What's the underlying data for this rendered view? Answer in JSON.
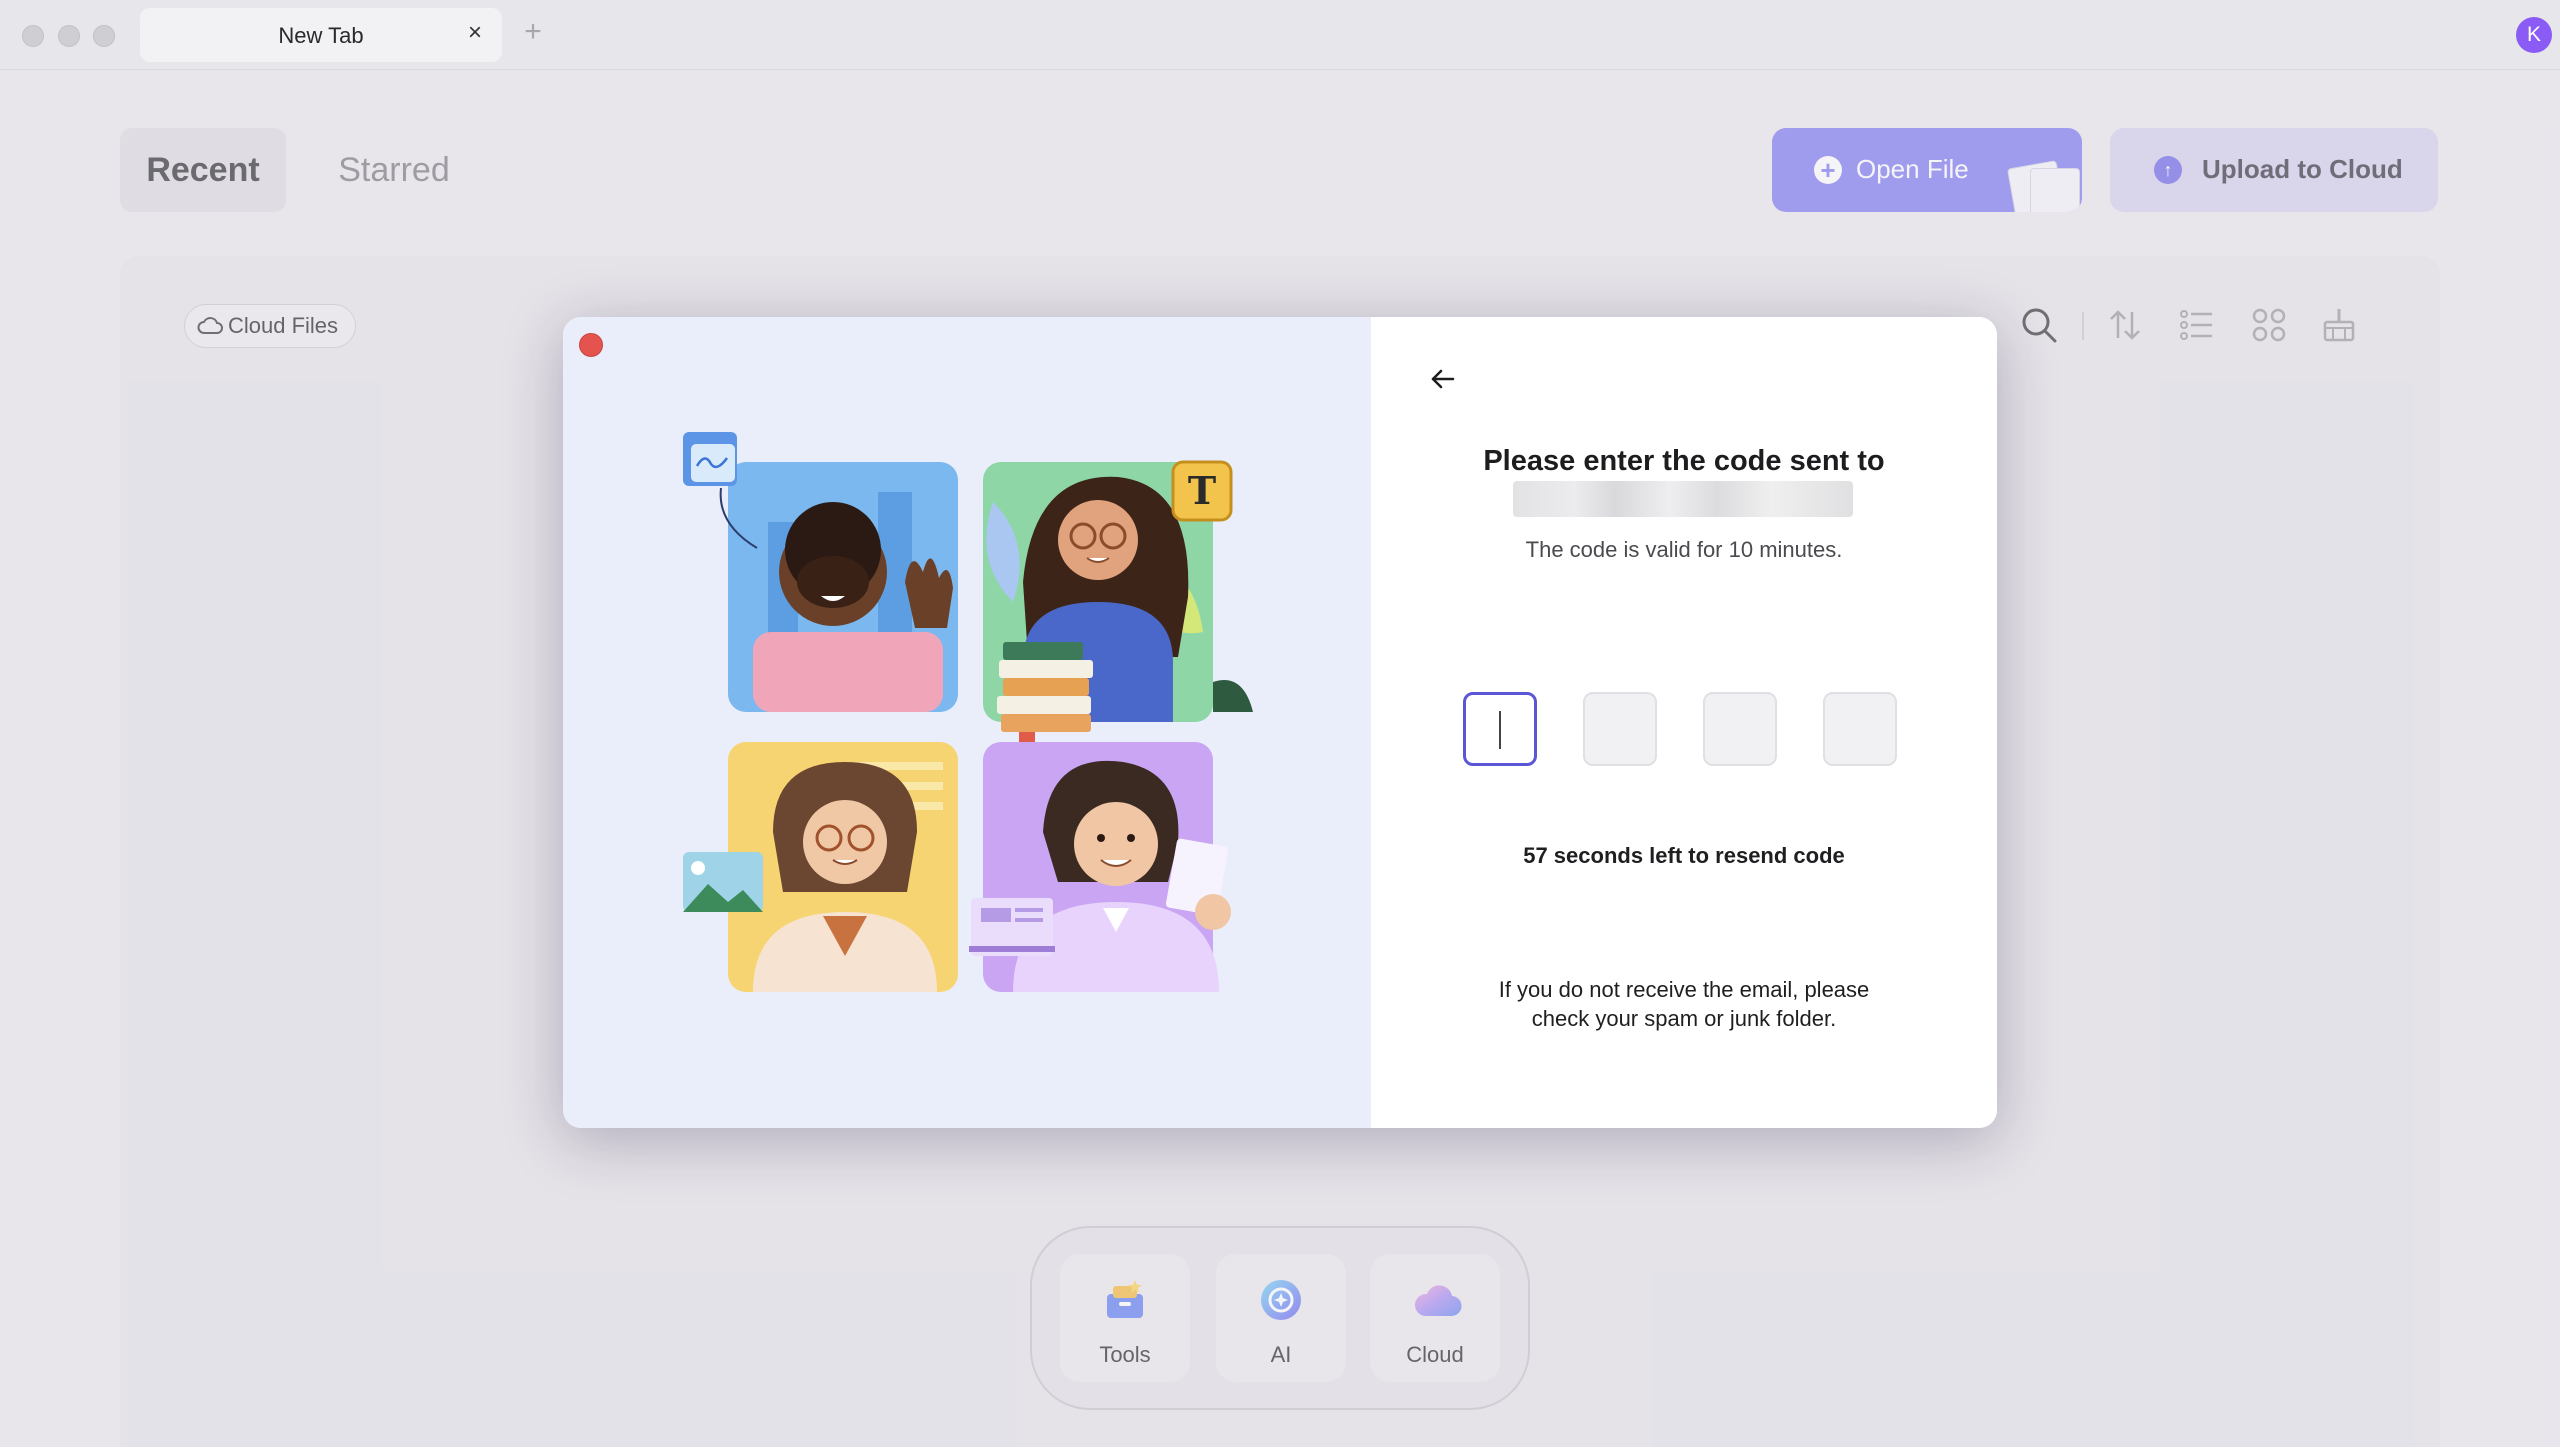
{
  "window": {
    "tab_title": "New Tab",
    "tab_close_glyph": "×",
    "new_tab_glyph": "+",
    "avatar_initial": "K"
  },
  "header": {
    "tabs": [
      {
        "label": "Recent",
        "active": true
      },
      {
        "label": "Starred",
        "active": false
      }
    ],
    "open_file_label": "Open File",
    "upload_label": "Upload to Cloud",
    "accent_color": "#7b79f3"
  },
  "panel": {
    "cloud_chip_label": "Cloud Files",
    "toolbar_icons": [
      "search-icon",
      "sort-icon",
      "list-view-icon",
      "grid-view-icon",
      "clean-icon"
    ]
  },
  "dock": {
    "items": [
      {
        "label": "Tools",
        "icon": "toolbox-icon"
      },
      {
        "label": "AI",
        "icon": "ai-icon"
      },
      {
        "label": "Cloud",
        "icon": "cloud-icon"
      }
    ]
  },
  "verify_dialog": {
    "title": "Please enter the code sent to",
    "email": "",
    "valid_note": "The code is valid for 10 minutes.",
    "code_digits": [
      "",
      "",
      "",
      ""
    ],
    "active_digit_index": 0,
    "resend_text": "57 seconds left to resend code",
    "spam_line1": "If you do not receive the email, please",
    "spam_line2": "check your spam or junk folder.",
    "illustration_badge": "T"
  }
}
